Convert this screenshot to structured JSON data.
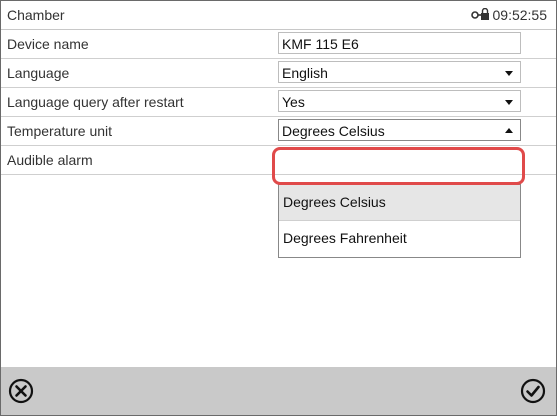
{
  "header": {
    "title": "Chamber",
    "time": "09:52:55"
  },
  "settings": [
    {
      "label": "Device name",
      "value": "KMF 115 E6",
      "type": "text"
    },
    {
      "label": "Language",
      "value": "English",
      "type": "select"
    },
    {
      "label": "Language query after restart",
      "value": "Yes",
      "type": "select"
    },
    {
      "label": "Temperature unit",
      "value": "Degrees Celsius",
      "type": "select",
      "open": true
    },
    {
      "label": "Audible alarm",
      "value": "",
      "type": "select"
    }
  ],
  "dropdown": {
    "options": [
      "Degrees Celsius",
      "Degrees Fahrenheit"
    ],
    "selected": "Degrees Celsius"
  },
  "footer": {
    "cancel_icon": "close-circle-icon",
    "confirm_icon": "check-circle-icon"
  },
  "colors": {
    "highlight": "#e04a4a",
    "footer_bg": "#c9c9c9"
  }
}
